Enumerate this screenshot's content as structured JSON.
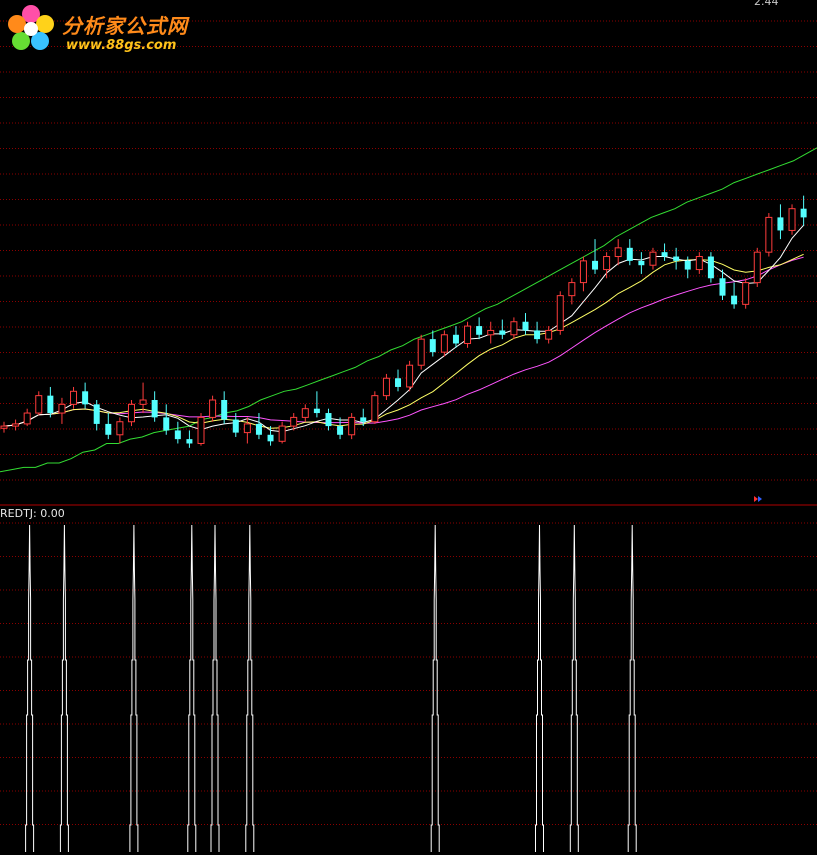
{
  "watermark": {
    "title": "分析家公式网",
    "url": "www.88gs.com",
    "logo_icon": "flower-logo-icon"
  },
  "price_panel": {
    "top_price_label": "2.44",
    "colors": {
      "up_candle": "#ff3c3c",
      "down_candle": "#54ffff",
      "ma5": "#ffffff",
      "ma10": "#ffff66",
      "ma20": "#ff55ff",
      "ma60": "#33dd33",
      "grid": "#8b0000",
      "separator": "#b00000"
    }
  },
  "indicator_panel": {
    "label": "REDTJ: 0.00"
  },
  "chart_data": [
    {
      "type": "candlestick",
      "panel": "price",
      "title": "",
      "series": [
        {
          "name": "",
          "values": [
            0.33,
            0.34,
            0.35,
            0.35,
            0.37,
            0.37,
            0.39,
            0.42,
            0.43,
            0.46,
            0.46,
            0.48,
            0.49,
            0.51,
            0.52,
            0.53,
            0.54,
            0.57,
            0.58,
            0.6,
            0.61,
            0.63,
            0.66,
            0.68,
            0.7,
            0.71,
            0.73,
            0.75,
            0.77,
            0.79,
            0.81,
            0.84,
            0.86,
            0.89,
            0.91,
            0.94,
            0.96,
            0.98,
            1.0,
            1.02,
            1.05,
            1.08,
            1.1,
            1.13,
            1.16,
            1.19,
            1.22,
            1.25,
            1.28,
            1.31,
            1.34,
            1.37,
            1.41,
            1.44,
            1.47,
            1.5,
            1.52,
            1.54,
            1.57,
            1.59,
            1.61,
            1.63,
            1.66,
            1.68,
            1.7,
            1.72,
            1.74,
            1.76,
            1.79,
            1.82
          ]
        }
      ],
      "ohlc_note": "price in data units",
      "candles": [
        [
          0.53,
          0.56,
          0.51,
          0.54
        ],
        [
          0.54,
          0.57,
          0.52,
          0.55
        ],
        [
          0.55,
          0.62,
          0.54,
          0.6
        ],
        [
          0.6,
          0.7,
          0.59,
          0.68
        ],
        [
          0.68,
          0.72,
          0.58,
          0.6
        ],
        [
          0.6,
          0.67,
          0.55,
          0.64
        ],
        [
          0.64,
          0.72,
          0.62,
          0.7
        ],
        [
          0.7,
          0.74,
          0.62,
          0.64
        ],
        [
          0.64,
          0.66,
          0.52,
          0.55
        ],
        [
          0.55,
          0.6,
          0.48,
          0.5
        ],
        [
          0.5,
          0.58,
          0.46,
          0.56
        ],
        [
          0.56,
          0.66,
          0.54,
          0.64
        ],
        [
          0.64,
          0.74,
          0.6,
          0.66
        ],
        [
          0.66,
          0.7,
          0.56,
          0.58
        ],
        [
          0.58,
          0.64,
          0.5,
          0.52
        ],
        [
          0.52,
          0.56,
          0.46,
          0.48
        ],
        [
          0.48,
          0.52,
          0.44,
          0.46
        ],
        [
          0.46,
          0.6,
          0.45,
          0.58
        ],
        [
          0.58,
          0.68,
          0.56,
          0.66
        ],
        [
          0.66,
          0.7,
          0.55,
          0.57
        ],
        [
          0.57,
          0.6,
          0.49,
          0.51
        ],
        [
          0.51,
          0.58,
          0.46,
          0.55
        ],
        [
          0.55,
          0.6,
          0.48,
          0.5
        ],
        [
          0.5,
          0.54,
          0.45,
          0.47
        ],
        [
          0.47,
          0.56,
          0.46,
          0.54
        ],
        [
          0.54,
          0.6,
          0.52,
          0.58
        ],
        [
          0.58,
          0.64,
          0.56,
          0.62
        ],
        [
          0.62,
          0.7,
          0.58,
          0.6
        ],
        [
          0.6,
          0.62,
          0.52,
          0.54
        ],
        [
          0.54,
          0.58,
          0.48,
          0.5
        ],
        [
          0.5,
          0.6,
          0.48,
          0.58
        ],
        [
          0.58,
          0.62,
          0.54,
          0.56
        ],
        [
          0.56,
          0.7,
          0.55,
          0.68
        ],
        [
          0.68,
          0.78,
          0.66,
          0.76
        ],
        [
          0.76,
          0.8,
          0.7,
          0.72
        ],
        [
          0.72,
          0.84,
          0.7,
          0.82
        ],
        [
          0.82,
          0.96,
          0.8,
          0.94
        ],
        [
          0.94,
          0.98,
          0.86,
          0.88
        ],
        [
          0.88,
          0.98,
          0.86,
          0.96
        ],
        [
          0.96,
          1.0,
          0.9,
          0.92
        ],
        [
          0.92,
          1.02,
          0.9,
          1.0
        ],
        [
          1.0,
          1.04,
          0.94,
          0.96
        ],
        [
          0.96,
          1.02,
          0.92,
          0.98
        ],
        [
          0.98,
          1.03,
          0.94,
          0.96
        ],
        [
          0.96,
          1.04,
          0.94,
          1.02
        ],
        [
          1.02,
          1.06,
          0.96,
          0.98
        ],
        [
          0.98,
          1.02,
          0.92,
          0.94
        ],
        [
          0.94,
          1.0,
          0.92,
          0.98
        ],
        [
          0.98,
          1.16,
          0.96,
          1.14
        ],
        [
          1.14,
          1.22,
          1.1,
          1.2
        ],
        [
          1.2,
          1.32,
          1.16,
          1.3
        ],
        [
          1.3,
          1.4,
          1.24,
          1.26
        ],
        [
          1.26,
          1.34,
          1.22,
          1.32
        ],
        [
          1.32,
          1.4,
          1.28,
          1.36
        ],
        [
          1.36,
          1.4,
          1.28,
          1.3
        ],
        [
          1.3,
          1.34,
          1.24,
          1.28
        ],
        [
          1.28,
          1.36,
          1.26,
          1.34
        ],
        [
          1.34,
          1.38,
          1.3,
          1.32
        ],
        [
          1.32,
          1.36,
          1.26,
          1.3
        ],
        [
          1.3,
          1.32,
          1.22,
          1.26
        ],
        [
          1.26,
          1.34,
          1.24,
          1.32
        ],
        [
          1.32,
          1.34,
          1.2,
          1.22
        ],
        [
          1.22,
          1.26,
          1.12,
          1.14
        ],
        [
          1.14,
          1.2,
          1.08,
          1.1
        ],
        [
          1.1,
          1.22,
          1.08,
          1.2
        ],
        [
          1.2,
          1.36,
          1.18,
          1.34
        ],
        [
          1.34,
          1.52,
          1.32,
          1.5
        ],
        [
          1.5,
          1.56,
          1.4,
          1.44
        ],
        [
          1.44,
          1.56,
          1.42,
          1.54
        ],
        [
          1.54,
          1.6,
          1.46,
          1.5
        ]
      ],
      "moving_averages": [
        "MA5",
        "MA10",
        "MA20",
        "MA60"
      ]
    },
    {
      "type": "line",
      "panel": "indicator",
      "title": "REDTJ: 0.00",
      "signal_positions": [
        1,
        4,
        10,
        15,
        17,
        20,
        36,
        45,
        48,
        53
      ],
      "signal_value": 1,
      "baseline_value": 0
    }
  ]
}
